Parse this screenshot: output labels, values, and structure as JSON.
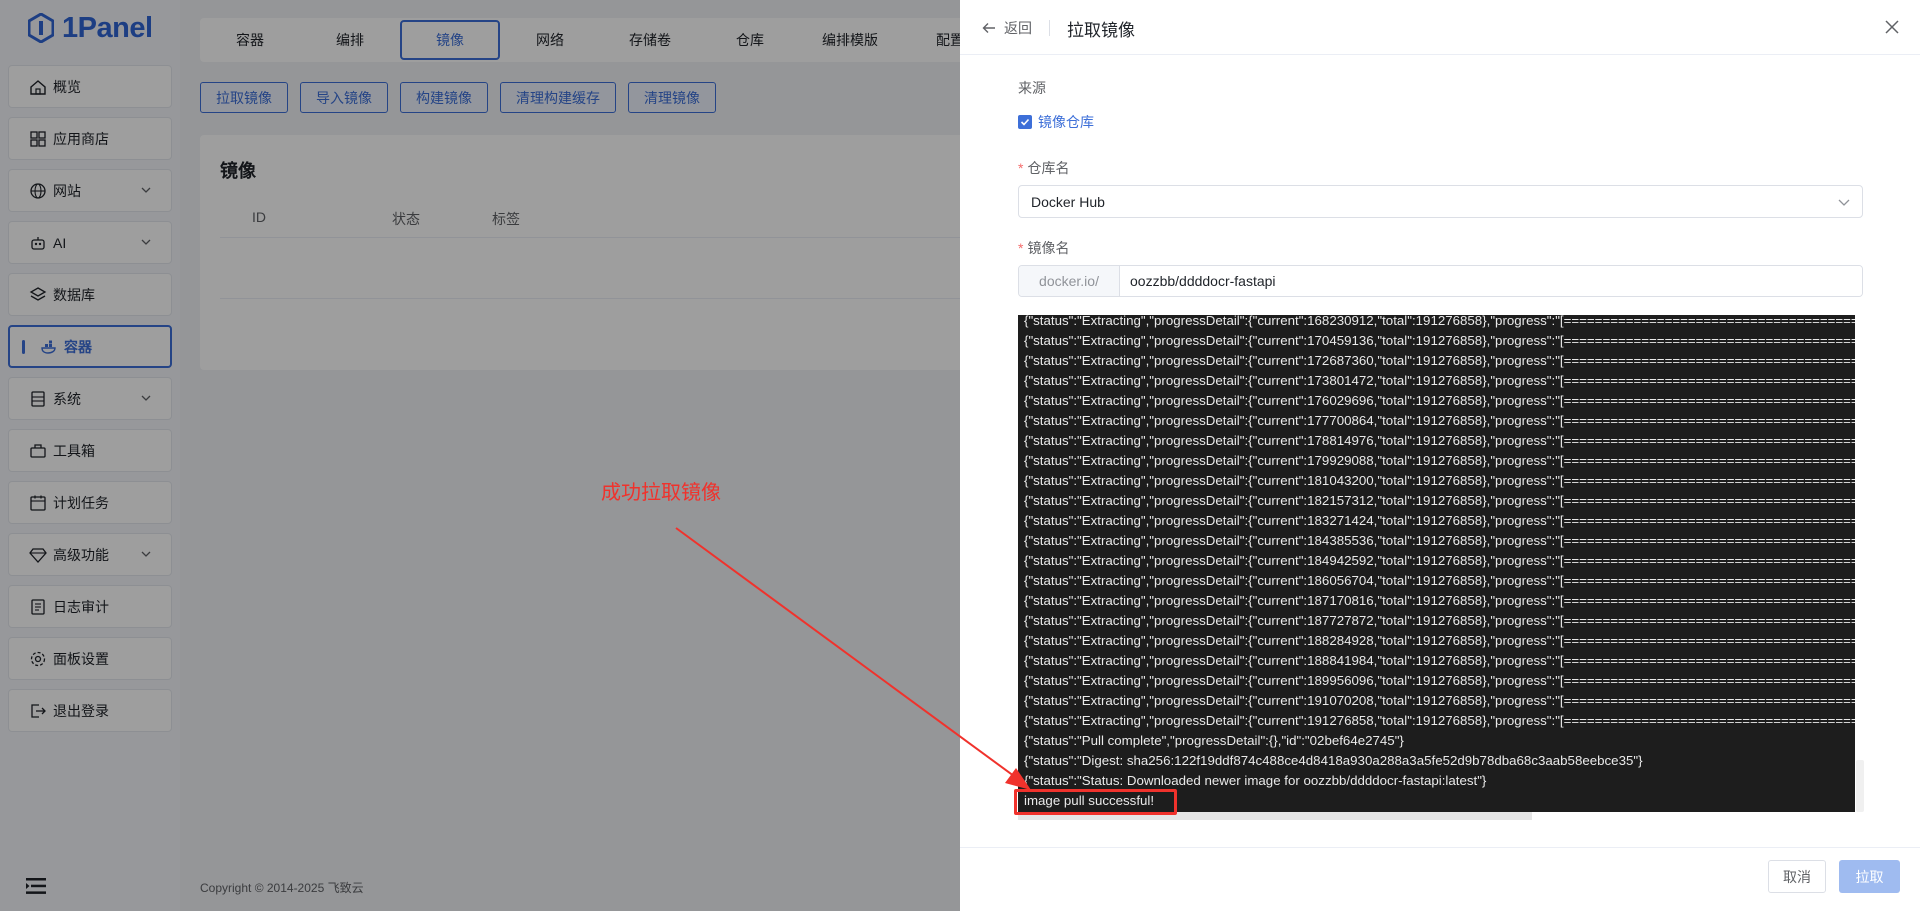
{
  "app": {
    "logo_text": "1Panel"
  },
  "sidebar": {
    "items": [
      {
        "label": "概览",
        "icon": "home-icon"
      },
      {
        "label": "应用商店",
        "icon": "grid-icon"
      },
      {
        "label": "网站",
        "icon": "globe-icon",
        "expandable": true
      },
      {
        "label": "AI",
        "icon": "robot-icon",
        "expandable": true
      },
      {
        "label": "数据库",
        "icon": "layers-icon"
      },
      {
        "label": "容器",
        "icon": "docker-icon",
        "active": true
      },
      {
        "label": "系统",
        "icon": "server-icon",
        "expandable": true
      },
      {
        "label": "工具箱",
        "icon": "toolbox-icon"
      },
      {
        "label": "计划任务",
        "icon": "calendar-icon"
      },
      {
        "label": "高级功能",
        "icon": "diamond-icon",
        "expandable": true
      },
      {
        "label": "日志审计",
        "icon": "log-icon"
      },
      {
        "label": "面板设置",
        "icon": "gear-icon"
      },
      {
        "label": "退出登录",
        "icon": "logout-icon"
      }
    ]
  },
  "tabs": [
    "容器",
    "编排",
    "镜像",
    "网络",
    "存储卷",
    "仓库",
    "编排模版",
    "配置"
  ],
  "active_tab": "镜像",
  "actions": [
    "拉取镜像",
    "导入镜像",
    "构建镜像",
    "清理构建缓存",
    "清理镜像"
  ],
  "panel": {
    "title": "镜像",
    "columns": [
      "ID",
      "状态",
      "标签"
    ]
  },
  "copyright": "Copyright © 2014-2025 飞致云",
  "annotation": {
    "text": "成功拉取镜像"
  },
  "drawer": {
    "back_label": "返回",
    "title": "拉取镜像",
    "source_label": "来源",
    "source_option": "镜像仓库",
    "repo_label": "仓库名",
    "repo_value": "Docker Hub",
    "image_label": "镜像名",
    "image_prefix": "docker.io/",
    "image_value": "oozzbb/ddddocr-fastapi",
    "log_lines": [
      "{\"status\":\"Extracting\",\"progressDetail\":{\"current\":168230912,\"total\":191276858},\"progress\":\"[==================================================>",
      "{\"status\":\"Extracting\",\"progressDetail\":{\"current\":170459136,\"total\":191276858},\"progress\":\"[==================================================>",
      "{\"status\":\"Extracting\",\"progressDetail\":{\"current\":172687360,\"total\":191276858},\"progress\":\"[==================================================>",
      "{\"status\":\"Extracting\",\"progressDetail\":{\"current\":173801472,\"total\":191276858},\"progress\":\"[==================================================>",
      "{\"status\":\"Extracting\",\"progressDetail\":{\"current\":176029696,\"total\":191276858},\"progress\":\"[==================================================>",
      "{\"status\":\"Extracting\",\"progressDetail\":{\"current\":177700864,\"total\":191276858},\"progress\":\"[==================================================>",
      "{\"status\":\"Extracting\",\"progressDetail\":{\"current\":178814976,\"total\":191276858},\"progress\":\"[==================================================>",
      "{\"status\":\"Extracting\",\"progressDetail\":{\"current\":179929088,\"total\":191276858},\"progress\":\"[==================================================>",
      "{\"status\":\"Extracting\",\"progressDetail\":{\"current\":181043200,\"total\":191276858},\"progress\":\"[==================================================>",
      "{\"status\":\"Extracting\",\"progressDetail\":{\"current\":182157312,\"total\":191276858},\"progress\":\"[==================================================>",
      "{\"status\":\"Extracting\",\"progressDetail\":{\"current\":183271424,\"total\":191276858},\"progress\":\"[==================================================>",
      "{\"status\":\"Extracting\",\"progressDetail\":{\"current\":184385536,\"total\":191276858},\"progress\":\"[==================================================>",
      "{\"status\":\"Extracting\",\"progressDetail\":{\"current\":184942592,\"total\":191276858},\"progress\":\"[==================================================>",
      "{\"status\":\"Extracting\",\"progressDetail\":{\"current\":186056704,\"total\":191276858},\"progress\":\"[==================================================>",
      "{\"status\":\"Extracting\",\"progressDetail\":{\"current\":187170816,\"total\":191276858},\"progress\":\"[==================================================>",
      "{\"status\":\"Extracting\",\"progressDetail\":{\"current\":187727872,\"total\":191276858},\"progress\":\"[==================================================>",
      "{\"status\":\"Extracting\",\"progressDetail\":{\"current\":188284928,\"total\":191276858},\"progress\":\"[==================================================>",
      "{\"status\":\"Extracting\",\"progressDetail\":{\"current\":188841984,\"total\":191276858},\"progress\":\"[==================================================>",
      "{\"status\":\"Extracting\",\"progressDetail\":{\"current\":189956096,\"total\":191276858},\"progress\":\"[==================================================>",
      "{\"status\":\"Extracting\",\"progressDetail\":{\"current\":191070208,\"total\":191276858},\"progress\":\"[==================================================>",
      "{\"status\":\"Extracting\",\"progressDetail\":{\"current\":191276858,\"total\":191276858},\"progress\":\"[==================================================>",
      "{\"status\":\"Pull complete\",\"progressDetail\":{},\"id\":\"02bef64e2745\"}",
      "{\"status\":\"Digest: sha256:122f19ddf874c488ce4d8418a930a288a3a5fe52d9b78dba68c3aab58eebce35\"}",
      "{\"status\":\"Status: Downloaded newer image for oozzbb/ddddocr-fastapi:latest\"}",
      "image pull successful!"
    ],
    "cancel_label": "取消",
    "pull_label": "拉取"
  },
  "colors": {
    "accent": "#3d6fd8",
    "annotation": "#f0322c",
    "log_bg": "#1d1d1d"
  }
}
